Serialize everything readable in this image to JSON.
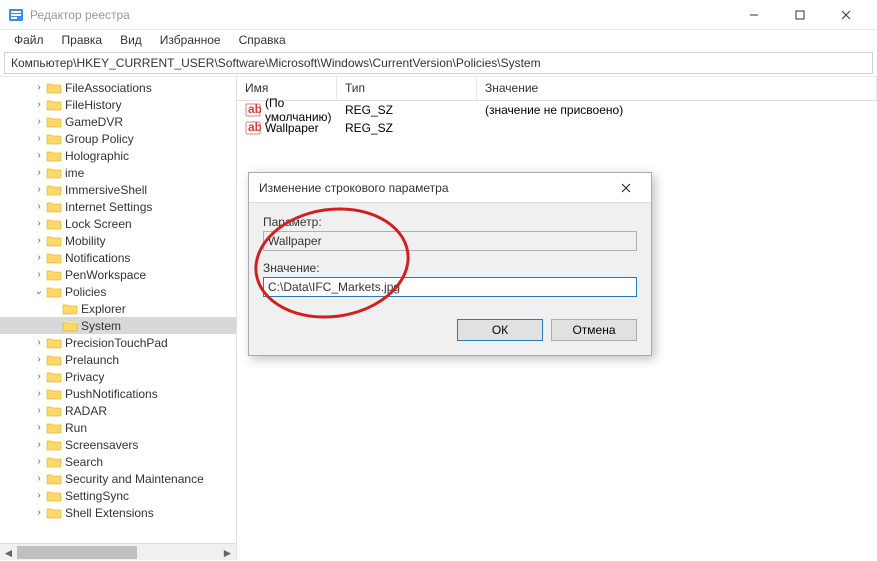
{
  "window": {
    "title": "Редактор реестра",
    "minimize_aria": "Minimize",
    "maximize_aria": "Maximize",
    "close_aria": "Close"
  },
  "menu": {
    "file": "Файл",
    "edit": "Правка",
    "view": "Вид",
    "favorites": "Избранное",
    "help": "Справка"
  },
  "address": "Компьютер\\HKEY_CURRENT_USER\\Software\\Microsoft\\Windows\\CurrentVersion\\Policies\\System",
  "tree": [
    {
      "label": "FileAssociations",
      "depth": 2,
      "expand": "closed"
    },
    {
      "label": "FileHistory",
      "depth": 2,
      "expand": "closed"
    },
    {
      "label": "GameDVR",
      "depth": 2,
      "expand": "closed"
    },
    {
      "label": "Group Policy",
      "depth": 2,
      "expand": "closed"
    },
    {
      "label": "Holographic",
      "depth": 2,
      "expand": "closed"
    },
    {
      "label": "ime",
      "depth": 2,
      "expand": "closed"
    },
    {
      "label": "ImmersiveShell",
      "depth": 2,
      "expand": "closed"
    },
    {
      "label": "Internet Settings",
      "depth": 2,
      "expand": "closed"
    },
    {
      "label": "Lock Screen",
      "depth": 2,
      "expand": "closed"
    },
    {
      "label": "Mobility",
      "depth": 2,
      "expand": "closed"
    },
    {
      "label": "Notifications",
      "depth": 2,
      "expand": "closed"
    },
    {
      "label": "PenWorkspace",
      "depth": 2,
      "expand": "closed"
    },
    {
      "label": "Policies",
      "depth": 2,
      "expand": "open"
    },
    {
      "label": "Explorer",
      "depth": 3,
      "expand": "none"
    },
    {
      "label": "System",
      "depth": 3,
      "expand": "none",
      "selected": true
    },
    {
      "label": "PrecisionTouchPad",
      "depth": 2,
      "expand": "closed"
    },
    {
      "label": "Prelaunch",
      "depth": 2,
      "expand": "closed"
    },
    {
      "label": "Privacy",
      "depth": 2,
      "expand": "closed"
    },
    {
      "label": "PushNotifications",
      "depth": 2,
      "expand": "closed"
    },
    {
      "label": "RADAR",
      "depth": 2,
      "expand": "closed"
    },
    {
      "label": "Run",
      "depth": 2,
      "expand": "closed"
    },
    {
      "label": "Screensavers",
      "depth": 2,
      "expand": "closed"
    },
    {
      "label": "Search",
      "depth": 2,
      "expand": "closed"
    },
    {
      "label": "Security and Maintenance",
      "depth": 2,
      "expand": "closed"
    },
    {
      "label": "SettingSync",
      "depth": 2,
      "expand": "closed"
    },
    {
      "label": "Shell Extensions",
      "depth": 2,
      "expand": "closed"
    }
  ],
  "columns": {
    "name": "Имя",
    "type": "Тип",
    "value": "Значение"
  },
  "rows": [
    {
      "name": "(По умолчанию)",
      "type": "REG_SZ",
      "value": "(значение не присвоено)"
    },
    {
      "name": "Wallpaper",
      "type": "REG_SZ",
      "value": ""
    }
  ],
  "dialog": {
    "title": "Изменение строкового параметра",
    "param_label": "Параметр:",
    "param_value": "Wallpaper",
    "value_label": "Значение:",
    "value_value": "C:\\Data\\IFC_Markets.jpg",
    "ok": "ОК",
    "cancel": "Отмена"
  }
}
